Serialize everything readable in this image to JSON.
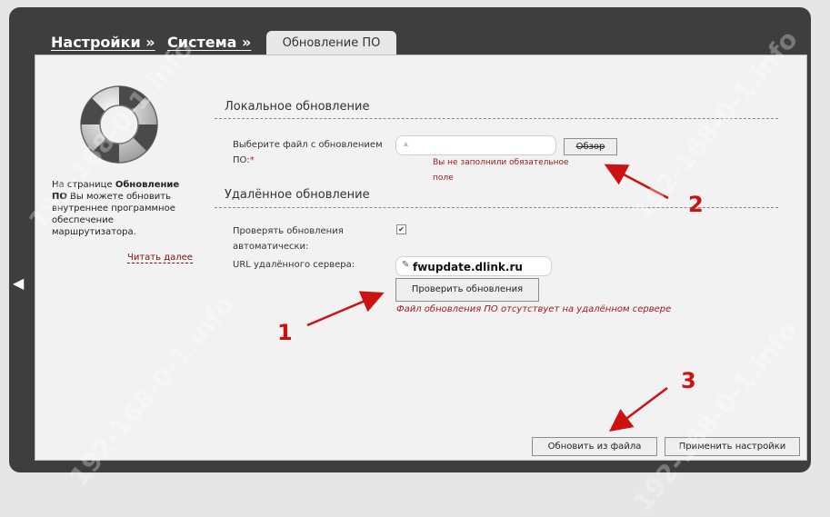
{
  "breadcrumbs": [
    "Настройки »",
    "Система »"
  ],
  "active_tab": "Обновление ПО",
  "sidebar": {
    "text_prefix": "На странице ",
    "text_bold": "Обновление ПО",
    "text_suffix": " Вы можете обновить внутреннее программное обеспечение маршрутизатора.",
    "read_more": "Читать далее"
  },
  "local": {
    "title": "Локальное обновление",
    "file_label": "Выберите файл с обновлением ПО:",
    "required_mark": "*",
    "browse_button": "Обзор",
    "error": "Вы не заполнили обязательное поле"
  },
  "remote": {
    "title": "Удалённое обновление",
    "auto_check_label": "Проверять обновления автоматически:",
    "auto_check_checked": true,
    "url_label": "URL удалённого сервера:",
    "url_value": "fwupdate.dlink.ru",
    "check_button": "Проверить обновления",
    "error": "Файл обновления ПО отсутствует на удалённом сервере"
  },
  "buttons": {
    "update_from_file": "Обновить из файла",
    "apply_settings": "Применить настройки"
  },
  "annotations": [
    "1",
    "2",
    "3"
  ],
  "watermark": "192-168-0-1.info",
  "colors": {
    "frame": "#3e3e3e",
    "annotation": "#cc1111",
    "error": "#a31a1a"
  }
}
